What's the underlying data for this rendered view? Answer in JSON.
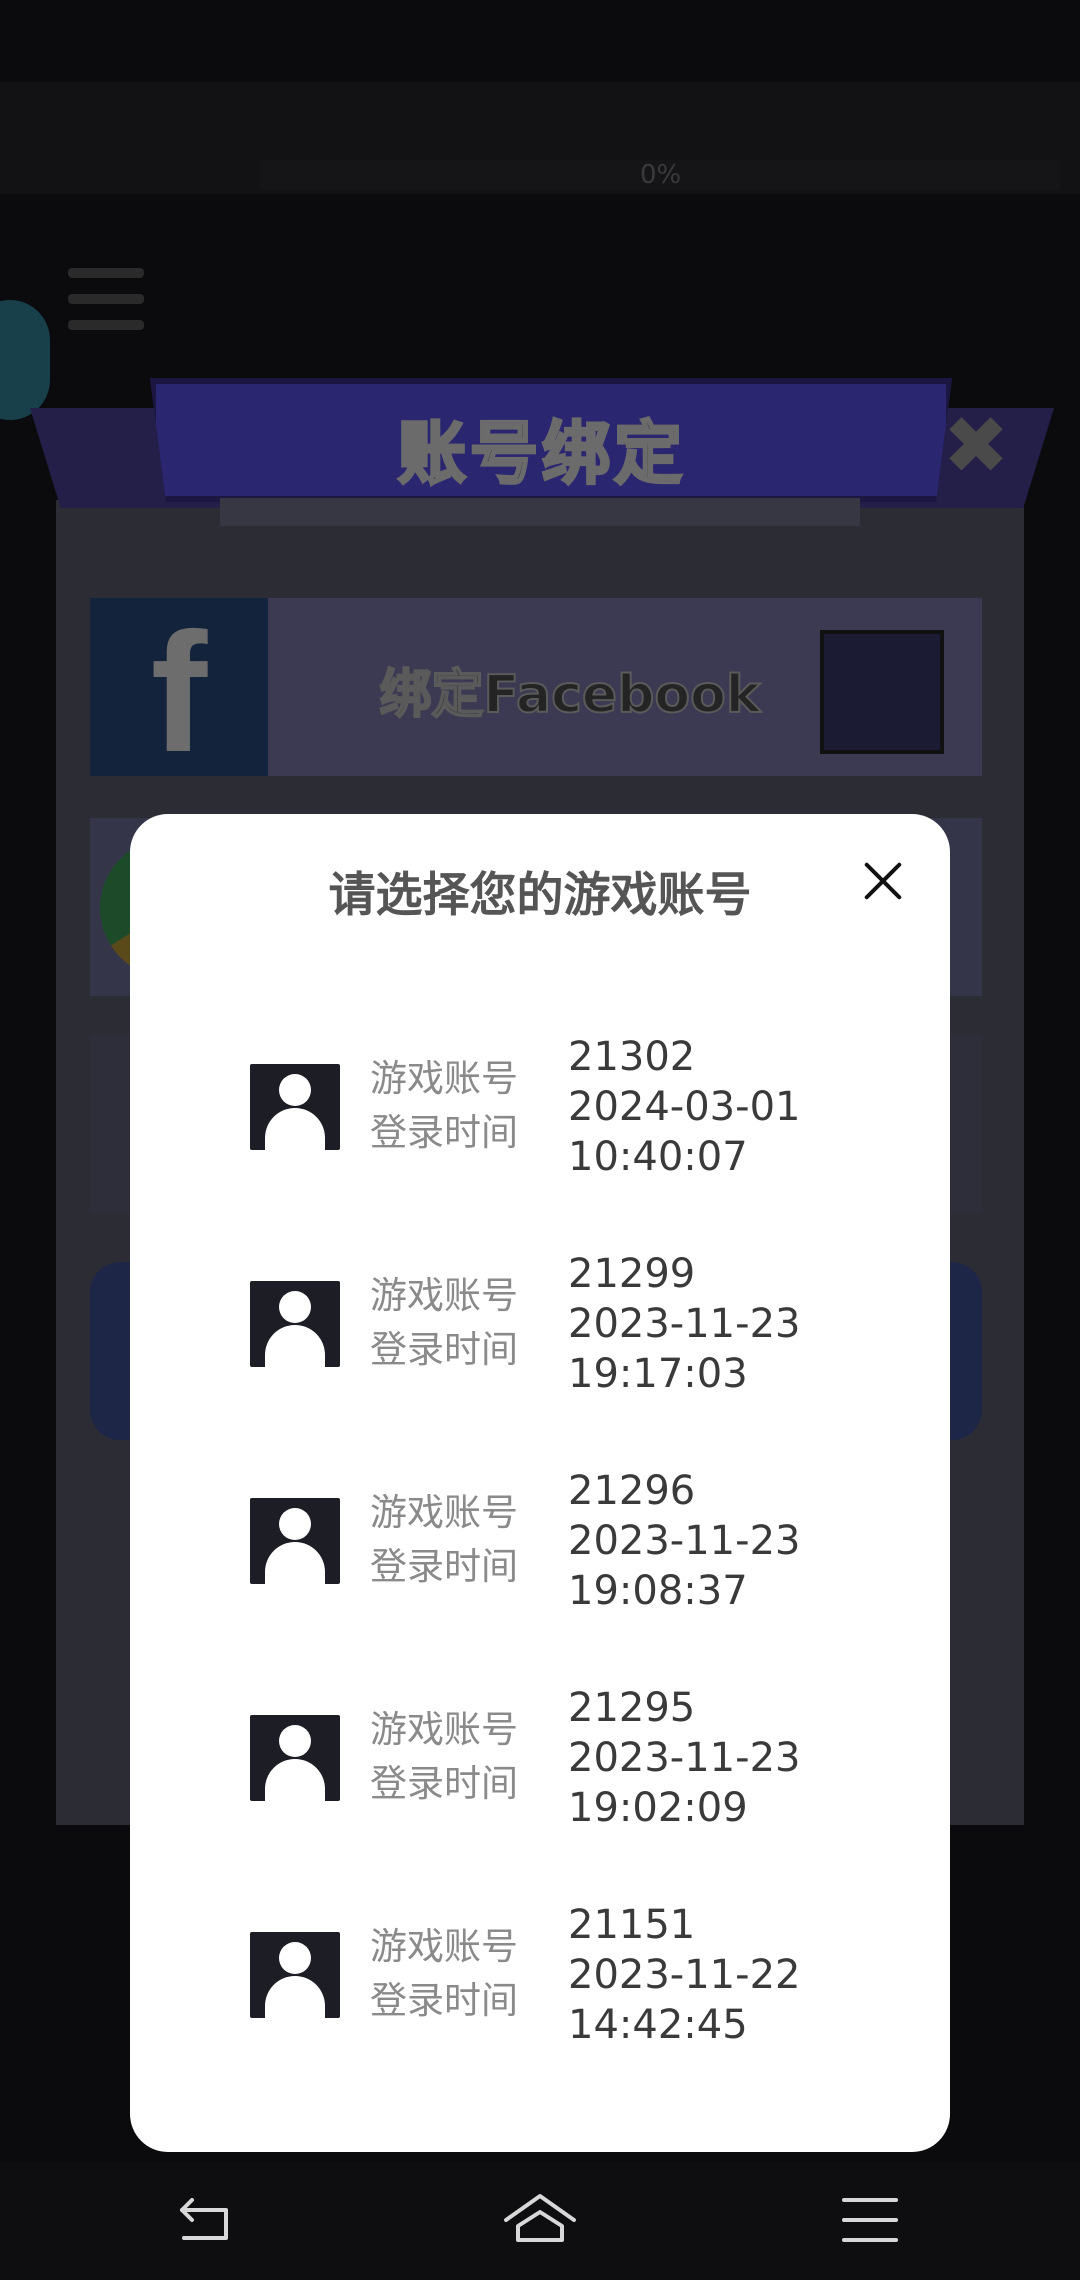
{
  "bind_dialog": {
    "title": "账号绑定",
    "facebook_label": "绑定Facebook",
    "status_percent": "0%"
  },
  "modal": {
    "title": "请选择您的游戏账号",
    "close_icon": "close-icon",
    "accounts": [
      {
        "label_account": "游戏账号",
        "label_time": "登录时间",
        "account_id": "21302",
        "date": "2024-03-01",
        "time": "10:40:07"
      },
      {
        "label_account": "游戏账号",
        "label_time": "登录时间",
        "account_id": "21299",
        "date": "2023-11-23",
        "time": "19:17:03"
      },
      {
        "label_account": "游戏账号",
        "label_time": "登录时间",
        "account_id": "21296",
        "date": "2023-11-23",
        "time": "19:08:37"
      },
      {
        "label_account": "游戏账号",
        "label_time": "登录时间",
        "account_id": "21295",
        "date": "2023-11-23",
        "time": "19:02:09"
      },
      {
        "label_account": "游戏账号",
        "label_time": "登录时间",
        "account_id": "21151",
        "date": "2023-11-22",
        "time": "14:42:45"
      }
    ]
  },
  "navbar": {
    "back_icon": "back-icon",
    "home_icon": "home-icon",
    "menu_icon": "menu-icon"
  },
  "colors": {
    "overlay": "#0b0b0d",
    "modal_bg": "#ffffff",
    "avatar_bg": "#1d1d26",
    "banner": "#2b2670"
  }
}
